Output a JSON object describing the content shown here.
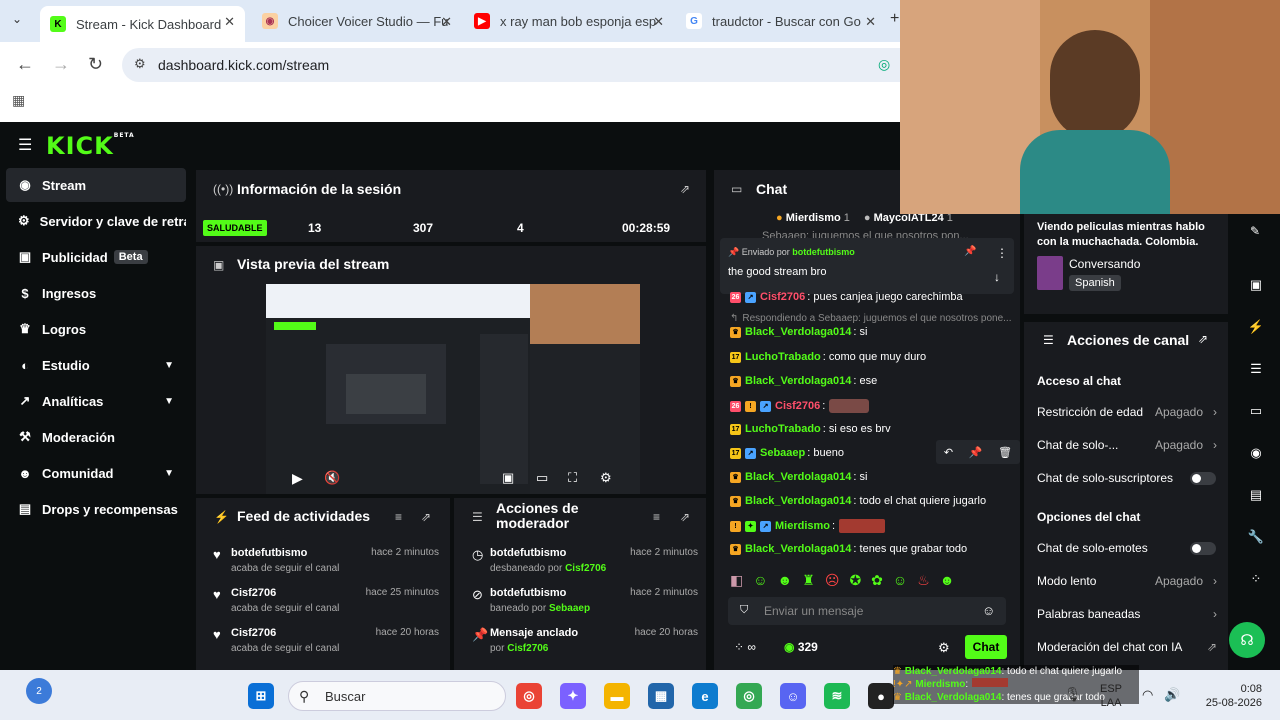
{
  "browser": {
    "tabs": [
      {
        "title": "Stream - Kick Dashboard",
        "active": true
      },
      {
        "title": "Choicer Voicer Studio — Fu",
        "active": false
      },
      {
        "title": "x ray man bob esponja esp",
        "active": false
      },
      {
        "title": "traudctor - Buscar con Go",
        "active": false
      }
    ],
    "url": "dashboard.kick.com/stream"
  },
  "kick": {
    "logo": "KICK",
    "logo_badge": "BETA"
  },
  "sidebar": {
    "items": [
      {
        "label": "Stream"
      },
      {
        "label": "Servidor y clave de retransmisión"
      },
      {
        "label": "Publicidad",
        "badge": "Beta"
      },
      {
        "label": "Ingresos"
      },
      {
        "label": "Logros"
      },
      {
        "label": "Estudio"
      },
      {
        "label": "Analíticas"
      },
      {
        "label": "Moderación"
      },
      {
        "label": "Comunidad"
      },
      {
        "label": "Drops y recompensas"
      }
    ]
  },
  "session": {
    "title": "Información de la sesión",
    "status": "SALUDABLE",
    "stats": [
      "13",
      "307",
      "4",
      "00:28:59"
    ]
  },
  "preview": {
    "title": "Vista previa del stream"
  },
  "activity": {
    "title": "Feed de actividades",
    "items": [
      {
        "name": "botdefutbismo",
        "sub": "acaba de seguir el canal",
        "time": "hace 2 minutos"
      },
      {
        "name": "Cisf2706",
        "sub": "acaba de seguir el canal",
        "time": "hace 25 minutos"
      },
      {
        "name": "Cisf2706",
        "sub": "acaba de seguir el canal",
        "time": "hace 20 horas"
      }
    ]
  },
  "mod": {
    "title_line1": "Acciones de",
    "title_line2": "moderador",
    "items": [
      {
        "name": "botdefutbismo",
        "sub_pre": "desbaneado por",
        "by": "Cisf2706",
        "time": "hace 2 minutos"
      },
      {
        "name": "botdefutbismo",
        "sub_pre": "baneado por",
        "by": "Sebaaep",
        "time": "hace 2 minutos"
      },
      {
        "name": "Mensaje anclado",
        "sub_pre": "por",
        "by": "Cisf2706",
        "time": "hace 20 horas"
      }
    ]
  },
  "chat": {
    "title": "Chat",
    "top_gifters": [
      {
        "name": "Mierdismo",
        "count": "1"
      },
      {
        "name": "MaycolATL24",
        "count": "1"
      }
    ],
    "pinned": {
      "label": "Enviado por",
      "user": "botdefutbismo",
      "text": "the good stream bro"
    },
    "partial_top": "Sebaaep: juguemos el que nosotros pon...",
    "messages": [
      {
        "user": "Cisf2706",
        "text": ": pues canjea juego carechimba",
        "color": "#ff4f6b"
      },
      {
        "reply": "Respondiendo a Sebaaep: juguemos el que nosotros pone..."
      },
      {
        "user": "Black_Verdolaga014",
        "text": ": si",
        "color": "#53fc18"
      },
      {
        "user": "LuchoTrabado",
        "text": ": como que muy duro",
        "color": "#53fc18"
      },
      {
        "user": "Black_Verdolaga014",
        "text": ": ese",
        "color": "#53fc18"
      },
      {
        "user": "Cisf2706",
        "text": ":",
        "color": "#ff4f6b"
      },
      {
        "user": "LuchoTrabado",
        "text": ": si eso es brv",
        "color": "#53fc18"
      },
      {
        "user": "Sebaaep",
        "text": ": bueno",
        "color": "#53fc18"
      },
      {
        "user": "Black_Verdolaga014",
        "text": ": si",
        "color": "#53fc18"
      },
      {
        "user": "Black_Verdolaga014",
        "text": ": todo el chat quiere jugarlo",
        "color": "#53fc18"
      },
      {
        "user": "Mierdismo",
        "text": ":",
        "color": "#53fc18"
      },
      {
        "user": "Black_Verdolaga014",
        "text": ": tenes que grabar todo",
        "color": "#53fc18"
      }
    ],
    "input_placeholder": "Enviar un mensaje",
    "viewers": "329",
    "send_label": "Chat",
    "infinite": "∞"
  },
  "stream_info": {
    "title": "Viendo peliculas mientras hablo con la muchachada. Colombia.",
    "category": "Conversando",
    "language": "Spanish"
  },
  "channel_actions": {
    "title": "Acciones de canal",
    "access_header": "Acceso al chat",
    "age": {
      "label": "Restricción de edad",
      "value": "Apagado"
    },
    "only": {
      "label": "Chat de solo-...",
      "value": "Apagado"
    },
    "subs": {
      "label": "Chat de solo-suscriptores"
    },
    "options_header": "Opciones del chat",
    "emotes": {
      "label": "Chat de solo-emotes"
    },
    "slow": {
      "label": "Modo lento",
      "value": "Apagado"
    },
    "banned": {
      "label": "Palabras baneadas"
    },
    "ai": {
      "label": "Moderación del chat con IA"
    }
  },
  "overlay_chat": [
    {
      "user": "Black_Verdolaga014",
      "text": ": todo el chat quiere jugarlo"
    },
    {
      "user": "Mierdismo",
      "text": ":"
    },
    {
      "user": "Black_Verdolaga014",
      "text": ": tenes que grabar todo"
    }
  ],
  "taskbar": {
    "search": "Buscar",
    "notif_count": "2",
    "lang1": "ESP",
    "lang2": "LAA",
    "time": "0:08",
    "date": "25-08-2026"
  },
  "colors": {
    "accent": "#53fc18",
    "panel": "#191b1f",
    "bg": "#0b0e0f"
  }
}
